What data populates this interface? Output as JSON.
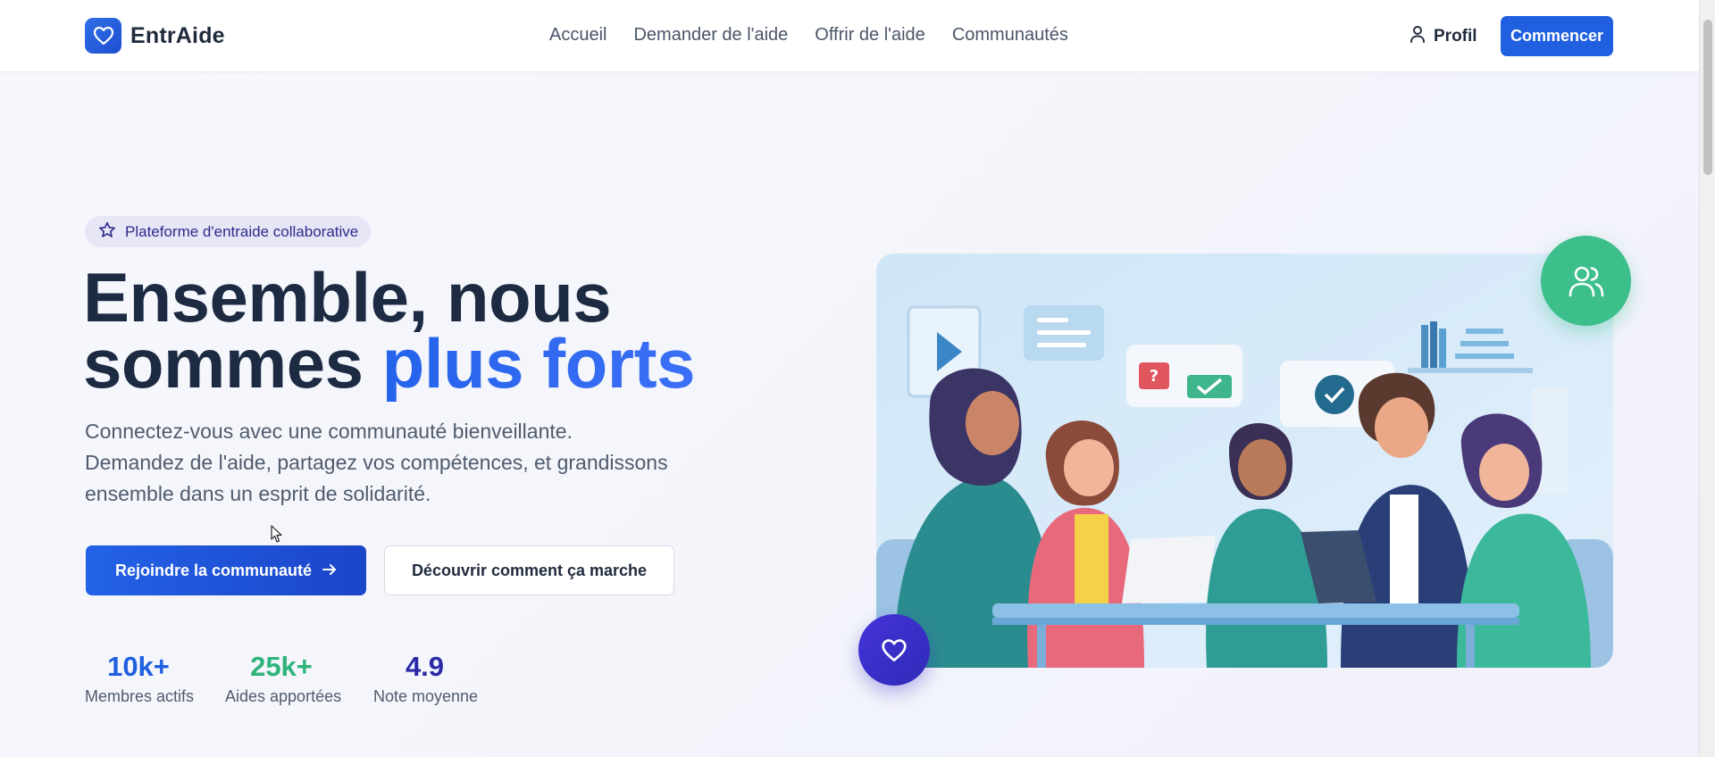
{
  "header": {
    "brand": "EntrAide",
    "nav": [
      {
        "label": "Accueil"
      },
      {
        "label": "Demander de l'aide"
      },
      {
        "label": "Offrir de l'aide"
      },
      {
        "label": "Communautés"
      }
    ],
    "profile_label": "Profil",
    "start_label": "Commencer"
  },
  "hero": {
    "badge": "Plateforme d'entraide collaborative",
    "title_line1": "Ensemble, nous",
    "title_line2_plain": "sommes ",
    "title_line2_accent": "plus forts",
    "lead": "Connectez-vous avec une communauté bienveillante. Demandez de l'aide, partagez vos compétences, et grandissons ensemble dans un esprit de solidarité.",
    "primary_button": "Rejoindre la communauté",
    "secondary_button": "Découvrir comment ça marche",
    "stats": [
      {
        "value": "10k+",
        "label": "Membres actifs",
        "color": "#1f5fe0"
      },
      {
        "value": "25k+",
        "label": "Aides apportées",
        "color": "#2fb47c"
      },
      {
        "value": "4.9",
        "label": "Note moyenne",
        "color": "#2a2aa8"
      }
    ]
  },
  "icons": {
    "brand": "heart-icon",
    "profile": "user-icon",
    "badge": "star-icon",
    "primary_button": "arrow-right-icon",
    "floating_top": "users-icon",
    "floating_bottom": "heart-icon"
  },
  "colors": {
    "primary": "#1f5fe0",
    "accent_green": "#3dbf8c",
    "accent_indigo": "#3b30c8",
    "heading": "#1c2a42"
  }
}
